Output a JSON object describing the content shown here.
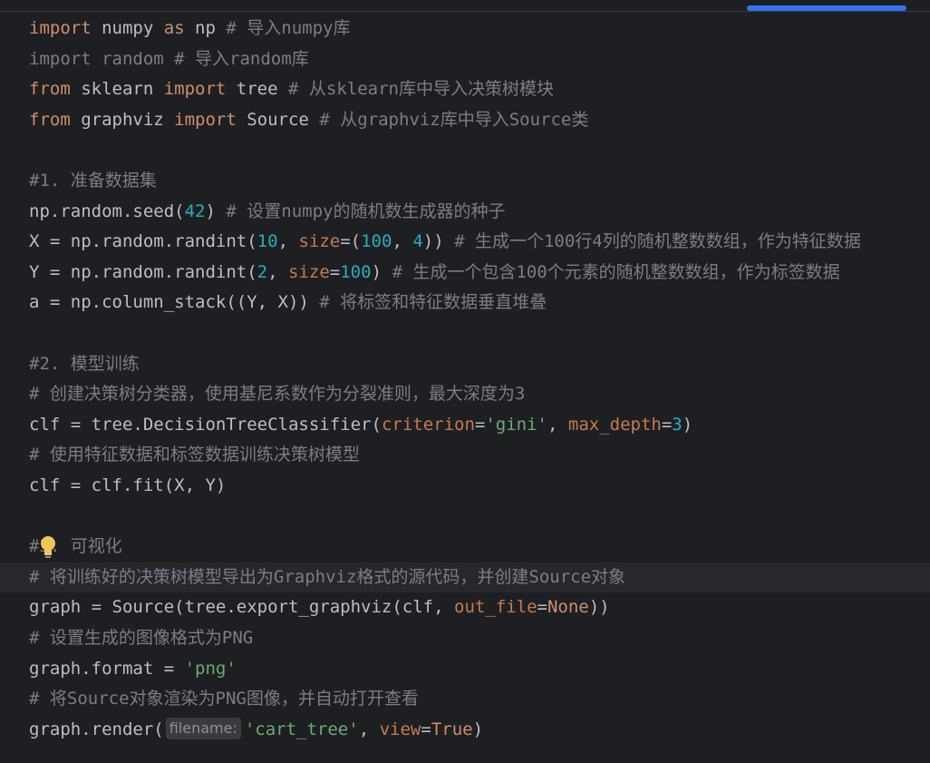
{
  "editor": {
    "lines": [
      {
        "tokens": [
          {
            "t": "import",
            "c": "kw"
          },
          {
            "t": " numpy ",
            "c": "tx"
          },
          {
            "t": "as",
            "c": "kw"
          },
          {
            "t": " np ",
            "c": "tx"
          },
          {
            "t": "# 导入numpy库",
            "c": "cm"
          }
        ]
      },
      {
        "tokens": [
          {
            "t": "import random # 导入random库",
            "c": "cm"
          }
        ]
      },
      {
        "tokens": [
          {
            "t": "from",
            "c": "kw"
          },
          {
            "t": " sklearn ",
            "c": "tx"
          },
          {
            "t": "import",
            "c": "kw"
          },
          {
            "t": " tree ",
            "c": "tx"
          },
          {
            "t": "# 从sklearn库中导入决策树模块",
            "c": "cm"
          }
        ]
      },
      {
        "tokens": [
          {
            "t": "from",
            "c": "kw"
          },
          {
            "t": " graphviz ",
            "c": "tx"
          },
          {
            "t": "import",
            "c": "kw"
          },
          {
            "t": " Source ",
            "c": "tx"
          },
          {
            "t": "# 从graphviz库中导入Source类",
            "c": "cm"
          }
        ]
      },
      {
        "tokens": []
      },
      {
        "tokens": [
          {
            "t": "#1. 准备数据集",
            "c": "cm"
          }
        ]
      },
      {
        "tokens": [
          {
            "t": "np.random.seed(",
            "c": "tx"
          },
          {
            "t": "42",
            "c": "num"
          },
          {
            "t": ") ",
            "c": "tx"
          },
          {
            "t": "# 设置numpy的随机数生成器的种子",
            "c": "cm"
          }
        ]
      },
      {
        "tokens": [
          {
            "t": "X = np.random.randint(",
            "c": "tx"
          },
          {
            "t": "10",
            "c": "num"
          },
          {
            "t": ", ",
            "c": "tx"
          },
          {
            "t": "size",
            "c": "param"
          },
          {
            "t": "=(",
            "c": "tx"
          },
          {
            "t": "100",
            "c": "num"
          },
          {
            "t": ", ",
            "c": "tx"
          },
          {
            "t": "4",
            "c": "num"
          },
          {
            "t": ")) ",
            "c": "tx"
          },
          {
            "t": "# 生成一个100行4列的随机整数数组，作为特征数据",
            "c": "cm"
          }
        ]
      },
      {
        "tokens": [
          {
            "t": "Y = np.random.randint(",
            "c": "tx"
          },
          {
            "t": "2",
            "c": "num"
          },
          {
            "t": ", ",
            "c": "tx"
          },
          {
            "t": "size",
            "c": "param"
          },
          {
            "t": "=",
            "c": "tx"
          },
          {
            "t": "100",
            "c": "num"
          },
          {
            "t": ") ",
            "c": "tx"
          },
          {
            "t": "# 生成一个包含100个元素的随机整数数组，作为标签数据",
            "c": "cm"
          }
        ]
      },
      {
        "tokens": [
          {
            "t": "a = np.column_stack((Y, X)) ",
            "c": "tx"
          },
          {
            "t": "# 将标签和特征数据垂直堆叠",
            "c": "cm"
          }
        ]
      },
      {
        "tokens": []
      },
      {
        "tokens": [
          {
            "t": "#2. 模型训练",
            "c": "cm"
          }
        ]
      },
      {
        "tokens": [
          {
            "t": "# 创建决策树分类器，使用基尼系数作为分裂准则，最大深度为3",
            "c": "cm"
          }
        ]
      },
      {
        "tokens": [
          {
            "t": "clf = tree.DecisionTreeClassifier(",
            "c": "tx"
          },
          {
            "t": "criterion",
            "c": "param"
          },
          {
            "t": "=",
            "c": "tx"
          },
          {
            "t": "'gini'",
            "c": "str"
          },
          {
            "t": ", ",
            "c": "tx"
          },
          {
            "t": "max_depth",
            "c": "param"
          },
          {
            "t": "=",
            "c": "tx"
          },
          {
            "t": "3",
            "c": "num"
          },
          {
            "t": ")",
            "c": "tx"
          }
        ]
      },
      {
        "tokens": [
          {
            "t": "# 使用特征数据和标签数据训练决策树模型",
            "c": "cm"
          }
        ]
      },
      {
        "tokens": [
          {
            "t": "clf = clf.fit(X, Y)",
            "c": "tx"
          }
        ]
      },
      {
        "tokens": []
      },
      {
        "tokens": [
          {
            "t": "#3. 可视化",
            "c": "cm"
          }
        ]
      },
      {
        "tokens": [
          {
            "t": "# 将训练好的决策树模型导出为Graphviz格式的源代码，并创建Source对象",
            "c": "cm"
          }
        ]
      },
      {
        "tokens": [
          {
            "t": "graph = Source(tree.export_graphviz(clf, ",
            "c": "tx"
          },
          {
            "t": "out_file",
            "c": "param"
          },
          {
            "t": "=",
            "c": "tx"
          },
          {
            "t": "None",
            "c": "kw"
          },
          {
            "t": "))",
            "c": "tx"
          }
        ]
      },
      {
        "tokens": [
          {
            "t": "# 设置生成的图像格式为PNG",
            "c": "cm"
          }
        ]
      },
      {
        "tokens": [
          {
            "t": "graph.format = ",
            "c": "tx"
          },
          {
            "t": "'png'",
            "c": "str"
          }
        ]
      },
      {
        "tokens": [
          {
            "t": "# 将Source对象渲染为PNG图像，并自动打开查看",
            "c": "cm"
          }
        ]
      },
      {
        "tokens": [
          {
            "t": "graph.render(",
            "c": "tx"
          },
          {
            "t": "filename:",
            "c": "hint"
          },
          {
            "t": "'cart_tree'",
            "c": "str"
          },
          {
            "t": ", ",
            "c": "tx"
          },
          {
            "t": "view",
            "c": "param"
          },
          {
            "t": "=",
            "c": "tx"
          },
          {
            "t": "True",
            "c": "kw"
          },
          {
            "t": ")",
            "c": "tx"
          }
        ]
      }
    ],
    "current_line_index": 18,
    "bulb_line_index": 17,
    "icons": {
      "bulb": "lightbulb-icon",
      "scrollbar": "horizontal-scrollbar"
    },
    "colors": {
      "background": "#1e1f22",
      "keyword": "#cf8e6d",
      "comment": "#7a7e85",
      "number": "#2aacb8",
      "string": "#6aab73",
      "param": "#c77a4e",
      "text": "#bcbec4",
      "bulb": "#f2c55c",
      "scroll_thumb": "#3574f0"
    }
  }
}
